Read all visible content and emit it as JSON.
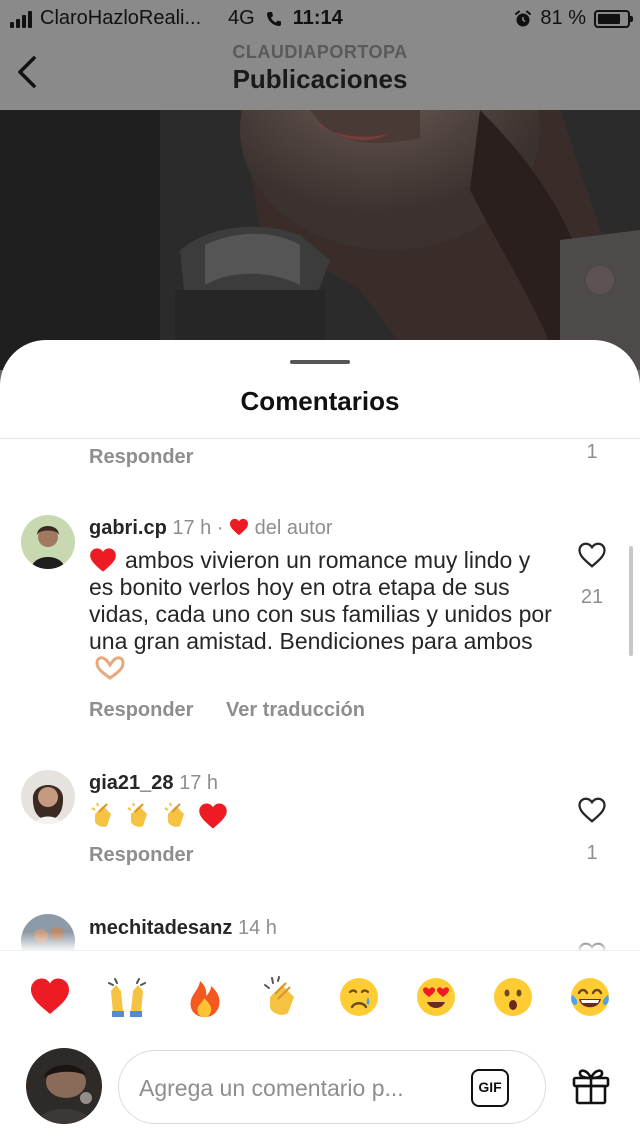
{
  "status_bar": {
    "carrier": "ClaroHazloReali...",
    "network": "4G",
    "time": "11:14",
    "battery": "81 %",
    "battery_level": 0.81
  },
  "header": {
    "username": "CLAUDIAPORTOPA",
    "title": "Publicaciones"
  },
  "sheet": {
    "title": "Comentarios"
  },
  "previous_comment": {
    "reply_label": "Responder",
    "likes": "1"
  },
  "comments": [
    {
      "username": "gabri.cp",
      "time": "17 h",
      "separator": "·",
      "author_badge": "del autor",
      "text": "ambos vivieron un romance muy lindo y es bonito verlos hoy en otra etapa de sus vidas, cada uno con sus familias y unidos por una gran amistad. Bendiciones para ambos",
      "likes": "21",
      "reply_label": "Responder",
      "translate_label": "Ver traducción"
    },
    {
      "username": "gia21_28",
      "time": "17 h",
      "likes": "1",
      "reply_label": "Responder"
    },
    {
      "username": "mechitadesanz",
      "time": "14 h"
    }
  ],
  "emoji_bar": [
    "heart-emoji",
    "raising-hands-emoji",
    "fire-emoji",
    "clapping-hands-emoji",
    "crying-face-emoji",
    "heart-eyes-emoji",
    "surprised-face-emoji",
    "tears-of-joy-emoji"
  ],
  "composer": {
    "placeholder": "Agrega un comentario p...",
    "gif_label": "GIF"
  },
  "colors": {
    "heart_red": "#ed1c24",
    "secondary_text": "#8e8e8e",
    "primary_text": "#262626",
    "emoji_yellow": "#ffcc33"
  }
}
